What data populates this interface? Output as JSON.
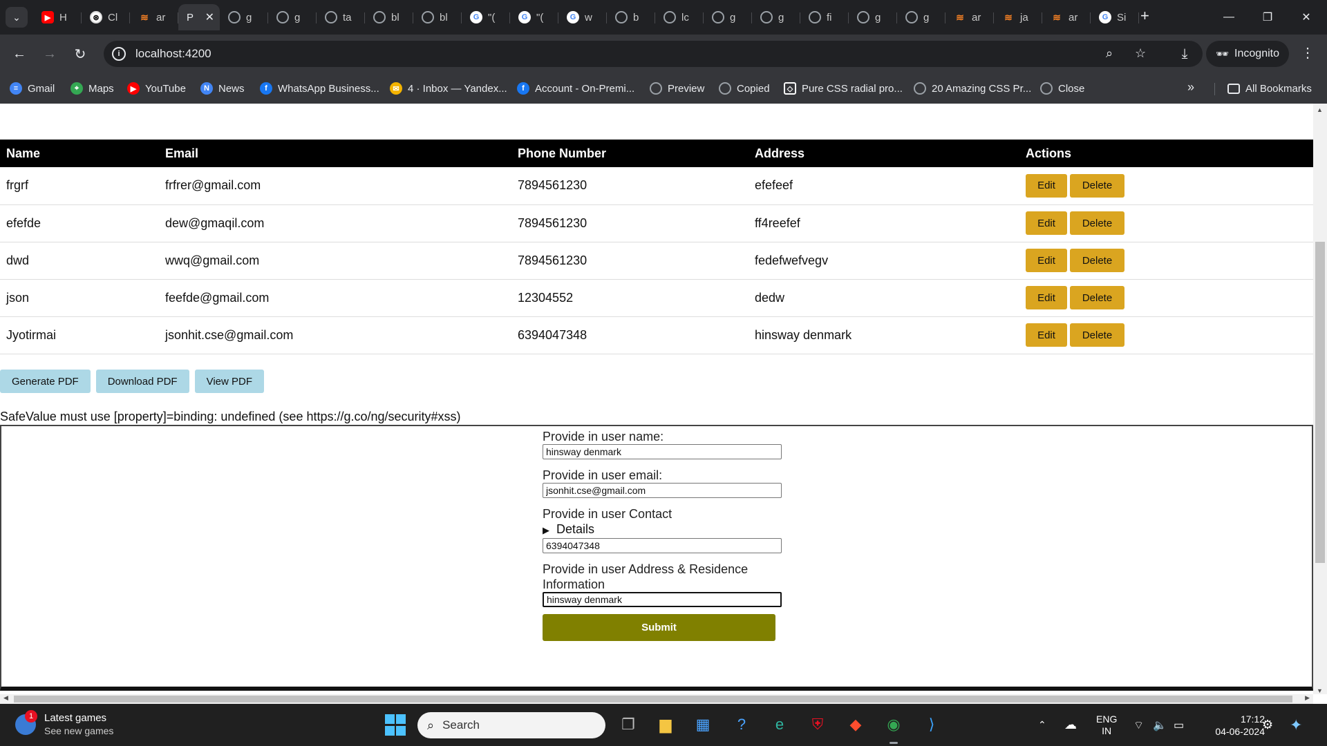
{
  "browser": {
    "tabs": [
      {
        "label": "H",
        "icon": "youtube-icon"
      },
      {
        "label": "Cl",
        "icon": "chatgpt-icon"
      },
      {
        "label": "ar",
        "icon": "stackoverflow-icon"
      },
      {
        "label": "P",
        "icon": "page-icon",
        "active": true
      },
      {
        "label": "g",
        "icon": "globe-icon"
      },
      {
        "label": "g",
        "icon": "globe-icon"
      },
      {
        "label": "ta",
        "icon": "globe-icon"
      },
      {
        "label": "bl",
        "icon": "globe-icon"
      },
      {
        "label": "bl",
        "icon": "globe-icon"
      },
      {
        "label": "\"(",
        "icon": "google-icon"
      },
      {
        "label": "\"(",
        "icon": "google-icon"
      },
      {
        "label": "w",
        "icon": "google-icon"
      },
      {
        "label": "b",
        "icon": "globe-icon"
      },
      {
        "label": "lc",
        "icon": "globe-icon"
      },
      {
        "label": "g",
        "icon": "globe-icon"
      },
      {
        "label": "g",
        "icon": "globe-icon"
      },
      {
        "label": "fi",
        "icon": "globe-icon"
      },
      {
        "label": "g",
        "icon": "globe-icon"
      },
      {
        "label": "g",
        "icon": "globe-icon"
      },
      {
        "label": "ar",
        "icon": "stackoverflow-icon"
      },
      {
        "label": "ja",
        "icon": "stackoverflow-icon"
      },
      {
        "label": "ar",
        "icon": "stackoverflow-icon"
      },
      {
        "label": "Si",
        "icon": "google-icon"
      }
    ],
    "url": "localhost:4200",
    "incognito_label": "Incognito",
    "bookmarks": [
      {
        "label": "Gmail",
        "icon": "docs-icon",
        "color": "#4285f4"
      },
      {
        "label": "Maps",
        "icon": "maps-icon",
        "color": "#34a853"
      },
      {
        "label": "YouTube",
        "icon": "youtube-icon",
        "color": "#ff0000"
      },
      {
        "label": "News",
        "icon": "news-icon",
        "color": "#4285f4"
      },
      {
        "label": "WhatsApp Business...",
        "icon": "facebook-icon",
        "color": "#1877f2"
      },
      {
        "label": "4 · Inbox — Yandex...",
        "icon": "mail-icon",
        "color": "#f4b400"
      },
      {
        "label": "Account - On-Premi...",
        "icon": "facebook-icon",
        "color": "#1877f2"
      },
      {
        "label": "Preview",
        "icon": "globe-icon",
        "color": "#9aa0a6"
      },
      {
        "label": "Copied",
        "icon": "globe-icon",
        "color": "#9aa0a6"
      },
      {
        "label": "Pure CSS radial pro...",
        "icon": "codepen-icon",
        "color": "#ffffff"
      },
      {
        "label": "20 Amazing CSS Pr...",
        "icon": "globe-icon",
        "color": "#9aa0a6"
      },
      {
        "label": "Close",
        "icon": "globe-icon",
        "color": "#9aa0a6"
      }
    ],
    "all_bookmarks_label": "All Bookmarks"
  },
  "table": {
    "headers": [
      "Name",
      "Email",
      "Phone Number",
      "Address",
      "Actions"
    ],
    "rows": [
      {
        "name": "frgrf",
        "email": "frfrer@gmail.com",
        "phone": "7894561230",
        "address": "efefeef"
      },
      {
        "name": "efefde",
        "email": "dew@gmaqil.com",
        "phone": "7894561230",
        "address": "ff4reefef"
      },
      {
        "name": "dwd",
        "email": "wwq@gmail.com",
        "phone": "7894561230",
        "address": "fedefwefvegv"
      },
      {
        "name": "json",
        "email": "feefde@gmail.com",
        "phone": "12304552",
        "address": "dedw"
      },
      {
        "name": "Jyotirmai",
        "email": "jsonhit.cse@gmail.com",
        "phone": "6394047348",
        "address": "hinsway denmark"
      }
    ],
    "edit_label": "Edit",
    "delete_label": "Delete",
    "action_color": "#daa520"
  },
  "pdf": {
    "generate_label": "Generate PDF",
    "download_label": "Download PDF",
    "view_label": "View PDF",
    "button_color": "#add8e6"
  },
  "error_message": "SafeValue must use [property]=binding: undefined (see https://g.co/ng/security#xss)",
  "form": {
    "name_label": "Provide in user name:",
    "name_value": "hinsway denmark",
    "email_label": "Provide in user email:",
    "email_value": "jsonhit.cse@gmail.com",
    "contact_label": "Provide in user Contact",
    "details_label": "Details",
    "contact_value": "6394047348",
    "address_label": "Provide in user Address & Residence Information",
    "address_value": "hinsway denmark",
    "submit_label": "Submit",
    "submit_color": "#808000"
  },
  "taskbar": {
    "news_title": "Latest games",
    "news_subtitle": "See new games",
    "news_badge": "1",
    "search_placeholder": "Search",
    "lang_top": "ENG",
    "lang_bottom": "IN",
    "time": "17:12",
    "date": "04-06-2024"
  }
}
